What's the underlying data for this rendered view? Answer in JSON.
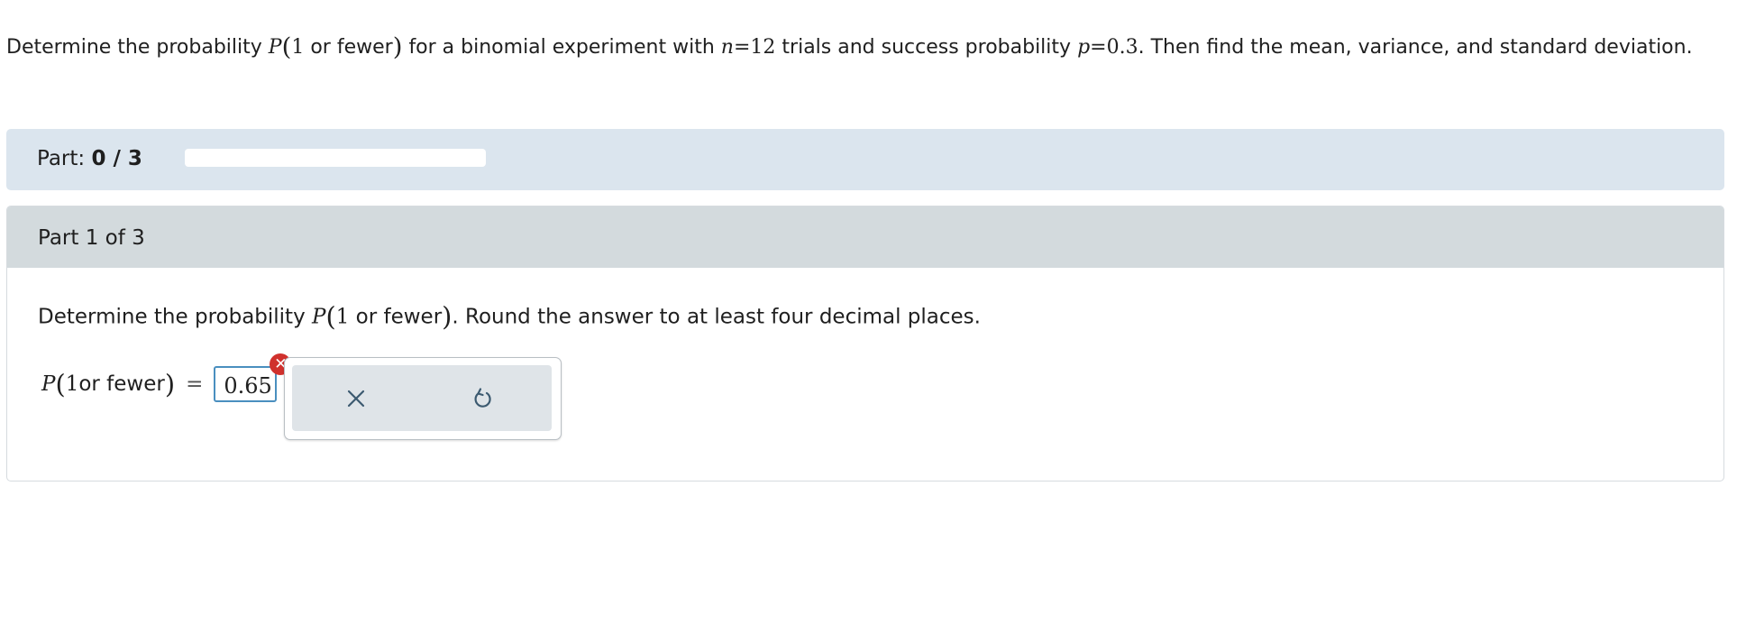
{
  "question": {
    "intro": "Determine the probability",
    "p_symbol": "P",
    "one": "1",
    "or_fewer": " or fewer",
    "middle": "for a binomial experiment with",
    "n_symbol": "n",
    "eq": "=",
    "n_value": "12",
    "trials": "trials and success probability",
    "p_var": "p",
    "p_value": "0.3",
    "ending": ". Then find the mean, variance, and standard deviation."
  },
  "part_progress": {
    "label": "Part:",
    "value": "0 / 3",
    "fraction": 0
  },
  "part": {
    "header": "Part 1 of 3",
    "instruction_before": "Determine the probability",
    "instruction_after": ". Round the answer to at least four decimal places.",
    "answer_lhs_p": "P",
    "answer_lhs_one": "1",
    "answer_lhs_or_fewer": " or fewer",
    "answer_eq": "=",
    "answer_value": "0.65",
    "error_mark": "✕"
  },
  "tools": {
    "clear_icon": "close-icon",
    "undo_icon": "undo-icon"
  },
  "colors": {
    "part_bar": "#dbe5ee",
    "part_header": "#d3dadd",
    "input_border": "#4a8fbf",
    "error": "#d0312d"
  }
}
